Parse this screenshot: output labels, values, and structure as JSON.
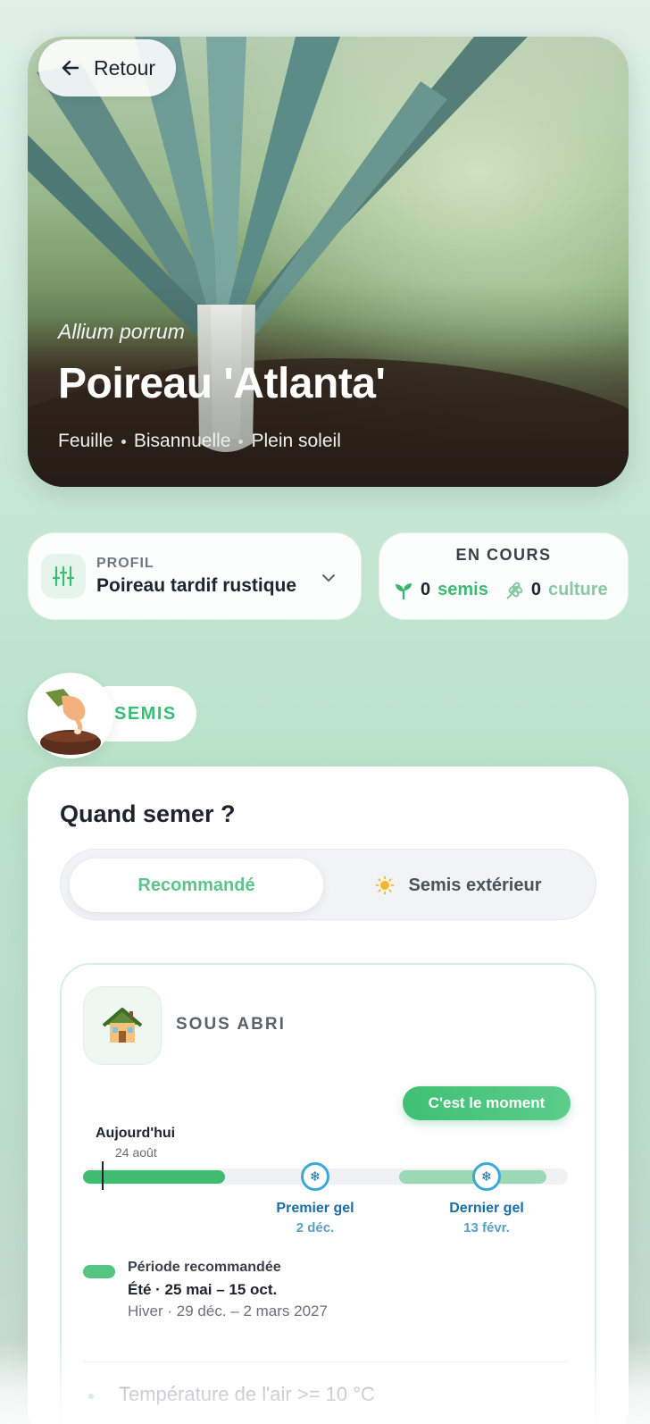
{
  "back_button": {
    "label": "Retour"
  },
  "hero": {
    "latin_name": "Allium porrum",
    "title": "Poireau 'Atlanta'",
    "tags": [
      "Feuille",
      "Bisannuelle",
      "Plein soleil"
    ]
  },
  "profile": {
    "label": "PROFIL",
    "value": "Poireau tardif rustique"
  },
  "en_cours": {
    "title": "EN COURS",
    "semis_count": "0",
    "semis_label": "semis",
    "culture_count": "0",
    "culture_label": "culture"
  },
  "section": {
    "badge_label": "SEMIS"
  },
  "when": {
    "title": "Quand semer ?",
    "tabs": [
      {
        "label": "Recommandé",
        "active": true
      },
      {
        "label": "Semis extérieur",
        "active": false
      }
    ]
  },
  "abri": {
    "label": "SOUS ABRI",
    "status": "C'est le moment",
    "today_label": "Aujourd'hui",
    "today_date": "24 août",
    "first_frost_label": "Premier gel",
    "first_frost_date": "2 déc.",
    "last_frost_label": "Dernier gel",
    "last_frost_date": "13 févr.",
    "legend_title": "Période recommandée",
    "period_summer": "Été · 25 mai – 15 oct.",
    "period_winter": "Hiver · 29 déc. – 2 mars 2027",
    "condition": "Température de l'air >= 10 °C"
  },
  "colors": {
    "accent": "#3fbc6f",
    "frost": "#3aa9d8"
  }
}
